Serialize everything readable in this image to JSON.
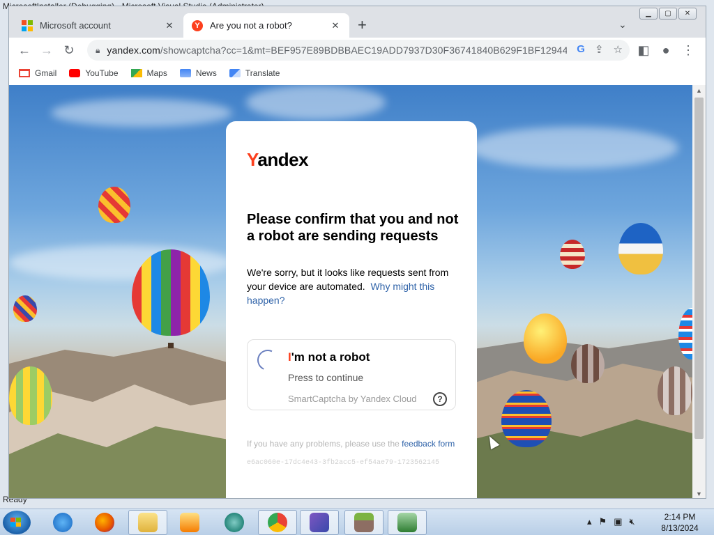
{
  "background_window": {
    "title": "MicrosoftInstaller (Debugging) - Microsoft Visual Studio (Administrator)",
    "status": "Ready"
  },
  "browser": {
    "tabs": [
      {
        "label": "Microsoft account",
        "icon": "microsoft-logo-icon"
      },
      {
        "label": "Are you not a robot?",
        "icon": "yandex-favicon-icon"
      }
    ],
    "new_tab_label": "+",
    "url_host": "yandex.com",
    "url_path": "/showcaptcha?cc=1&mt=BEF957E89BDBBAEC19ADD7937D30F36741840B629F1BF129441...",
    "bookmarks": [
      {
        "label": "Gmail",
        "icon": "gmail-icon"
      },
      {
        "label": "YouTube",
        "icon": "youtube-icon"
      },
      {
        "label": "Maps",
        "icon": "maps-icon"
      },
      {
        "label": "News",
        "icon": "news-icon"
      },
      {
        "label": "Translate",
        "icon": "translate-icon"
      }
    ]
  },
  "captcha": {
    "logo_first": "Y",
    "logo_rest": "andex",
    "heading": "Please confirm that you and not a robot are sending requests",
    "description": "We're sorry, but it looks like requests sent from your device are automated.",
    "why_link": "Why might this happen?",
    "checkbox_title_first": "I",
    "checkbox_title_rest": "'m not a robot",
    "checkbox_sub": "Press to continue",
    "powered_by": "SmartCaptcha by Yandex Cloud",
    "help_label": "?",
    "problems_text": "If you have any problems, please use the",
    "feedback_link": "feedback form",
    "hash": "e6ac060e-17dc4e43-3fb2acc5-ef54ae79-1723562145"
  },
  "taskbar": {
    "time": "2:14 PM",
    "date": "8/13/2024",
    "apps": [
      "internet-explorer-icon",
      "firefox-icon",
      "file-explorer-icon",
      "media-player-icon",
      "app-icon",
      "chrome-icon",
      "visual-studio-icon",
      "minecraft-icon",
      "installer-icon"
    ]
  }
}
